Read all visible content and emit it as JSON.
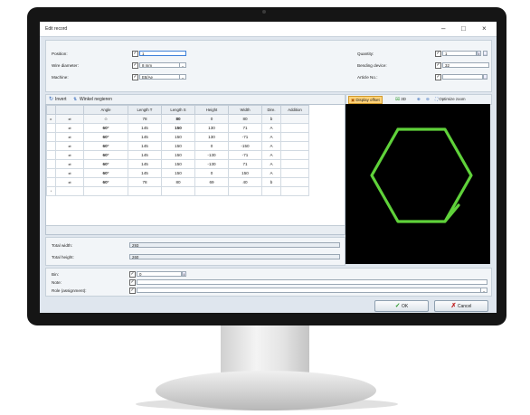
{
  "window": {
    "title": "Edit record",
    "min": "–",
    "max": "□",
    "close": "×"
  },
  "form": {
    "position_label": "Position:",
    "position_value": "1",
    "wire_label": "Wire diameter:",
    "wire_value": "8 mm",
    "machine_label": "Machine:",
    "machine_value": "E8/Ae",
    "quantity_label": "Quantity:",
    "quantity_value": "1",
    "bending_label": "Bending device:",
    "bending_value": "32",
    "article_label": "Article No.:",
    "article_value": ""
  },
  "toolbar": {
    "invert": "Invert",
    "negate": "Winkel negieren"
  },
  "table": {
    "columns": [
      "",
      "",
      "Angle",
      "Length T",
      "Length S",
      "Height",
      "Width",
      "Dire.",
      "Addition"
    ],
    "rows": [
      [
        "",
        "",
        "78",
        "80",
        "0",
        "80",
        "b",
        ""
      ],
      [
        "60°",
        "145",
        "150",
        "130",
        "71",
        "A",
        ""
      ],
      [
        "60°",
        "145",
        "150",
        "130",
        "-71",
        "A",
        ""
      ],
      [
        "60°",
        "145",
        "150",
        "0",
        "-150",
        "A",
        ""
      ],
      [
        "60°",
        "145",
        "150",
        "-130",
        "-71",
        "A",
        ""
      ],
      [
        "60°",
        "145",
        "150",
        "-130",
        "71",
        "A",
        ""
      ],
      [
        "60°",
        "145",
        "150",
        "0",
        "150",
        "A",
        ""
      ],
      [
        "60°",
        "78",
        "80",
        "69",
        "40",
        "b",
        ""
      ]
    ]
  },
  "preview": {
    "display_offset": "Display offset",
    "three_d": "3D",
    "optimize_zoom": "Optimize zoom",
    "shape_color": "#5fd13a"
  },
  "summary": {
    "width_label": "Total width:",
    "width_value": "293",
    "height_label": "Total height:",
    "height_value": "260"
  },
  "extra": {
    "bin_label": "Bin:",
    "bin_value": "0",
    "note_label": "Note:",
    "role_label": "Role (assignment):"
  },
  "buttons": {
    "ok": "OK",
    "cancel": "Cancel"
  }
}
